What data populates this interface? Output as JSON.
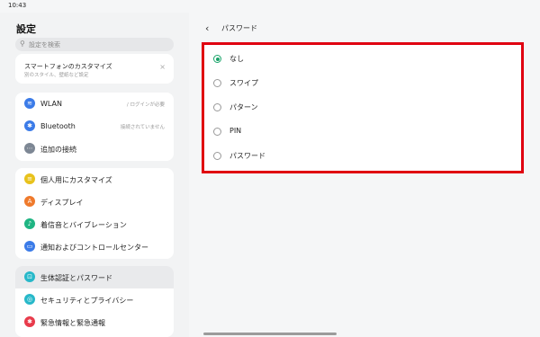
{
  "status": {
    "time": "10:43",
    "dots": "•••",
    "right_icons": "✱ ◌ ≋ ▭"
  },
  "left": {
    "title": "設定",
    "search_placeholder": "設定を検索",
    "promo": {
      "title": "スマートフォンのカスタマイズ",
      "subtitle": "別のスタイル、壁紙など設定",
      "close": "×"
    },
    "network": [
      {
        "label": "WLAN",
        "value": "/ ログインが必要",
        "color": "#3b7be8",
        "icon": "≋"
      },
      {
        "label": "Bluetooth",
        "value": "接続されていません",
        "color": "#3b7be8",
        "icon": "✱"
      },
      {
        "label": "追加の接続",
        "value": "",
        "color": "#7d8794",
        "icon": "⋯"
      }
    ],
    "custom": [
      {
        "label": "個人用にカスタマイズ",
        "color": "#e8c21c",
        "icon": "≡"
      },
      {
        "label": "ディスプレイ",
        "color": "#ef7a2c",
        "icon": "A"
      },
      {
        "label": "着信音とバイブレーション",
        "color": "#1fb583",
        "icon": "♪"
      },
      {
        "label": "通知およびコントロールセンター",
        "color": "#3b7be8",
        "icon": "▭"
      }
    ],
    "security": [
      {
        "label": "生体認証とパスワード",
        "color": "#27b8c9",
        "icon": "🔒"
      },
      {
        "label": "セキュリティとプライバシー",
        "color": "#27b8c9",
        "icon": "◎"
      },
      {
        "label": "緊急情報と緊急通報",
        "color": "#e83b4b",
        "icon": "✱"
      }
    ]
  },
  "right": {
    "back": "‹",
    "title": "パスワード",
    "options": [
      {
        "label": "なし",
        "checked": true
      },
      {
        "label": "スワイプ",
        "checked": false
      },
      {
        "label": "パターン",
        "checked": false
      },
      {
        "label": "PIN",
        "checked": false
      },
      {
        "label": "パスワード",
        "checked": false
      }
    ],
    "accent": "#1aa46a",
    "highlight": "#e00010"
  }
}
